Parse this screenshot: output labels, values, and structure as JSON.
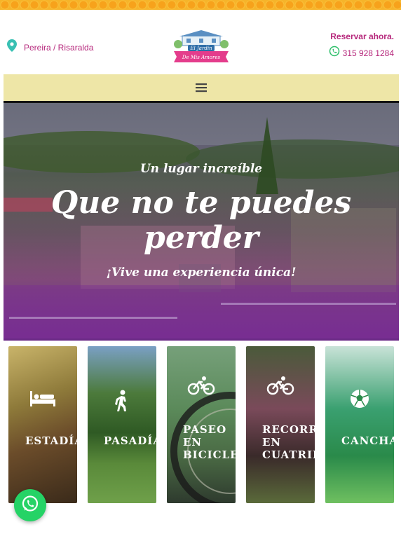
{
  "header": {
    "location": "Pereira / Risaralda",
    "logo_line1": "El Jardín",
    "logo_line2": "De Mis Amores",
    "reserve_label": "Reservar ahora.",
    "phone": "315 928 1284"
  },
  "hero": {
    "subtitle": "Un lugar increíble",
    "title_line1": "Que no te puedes",
    "title_line2": "perder",
    "tagline": "¡Vive una experiencia única!"
  },
  "cards": [
    {
      "label": "ESTADÍA",
      "icon": "bed-icon"
    },
    {
      "label": "PASADÍA",
      "icon": "walking-icon"
    },
    {
      "label": "PASEO EN BICICLETA",
      "line1": "PASEO",
      "line2": "EN",
      "line3": "BICICLETA",
      "icon": "bicycle-icon"
    },
    {
      "label": "RECORRIDO EN CUATRIMOTO",
      "line1": "RECORRIDO",
      "line2": "EN",
      "line3": "CUATRIMOTO",
      "icon": "bicycle-icon"
    },
    {
      "label": "CANCHA",
      "icon": "soccer-ball-icon"
    }
  ],
  "colors": {
    "brand": "#b6287c",
    "nav": "#eee6a7",
    "whatsapp": "#25d366"
  }
}
